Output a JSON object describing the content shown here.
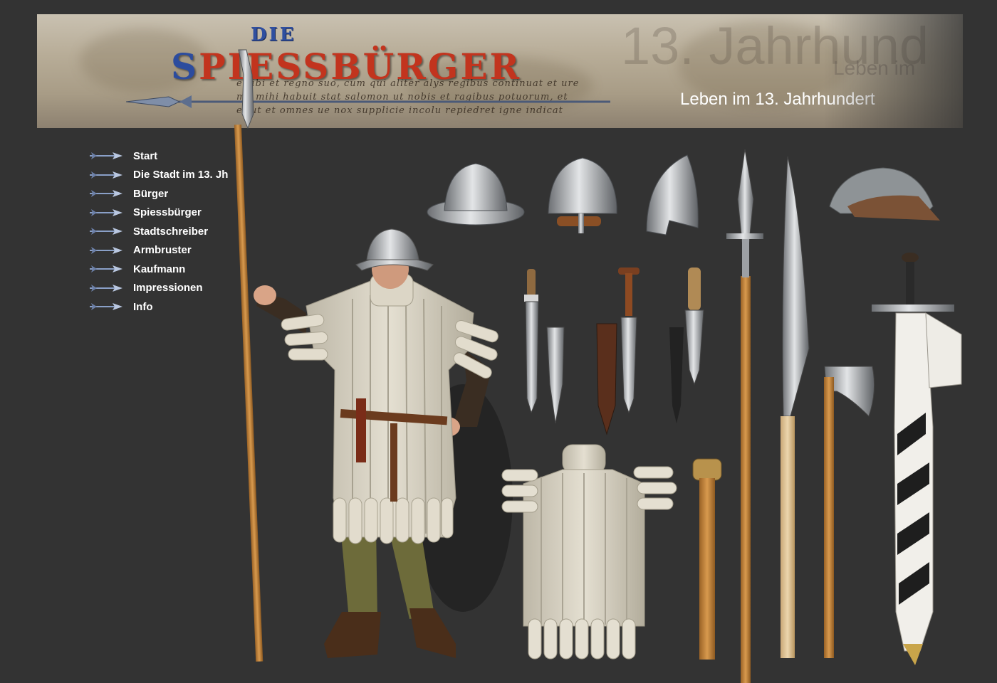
{
  "header": {
    "logo_die": "DIE",
    "logo_main_first": "S",
    "logo_main_rest": "PIESSBÜRGER",
    "subtitle": "Leben im 13. Jahrhundert",
    "bg_year_text": "13. Jahrhund",
    "bg_leben_text": "Leben im",
    "script_lines": [
      "e sibi et regno suo, cum qui aliter alys regibus continuat et ure",
      "me mihi habuit stat salomon ut nobis et ragibus potuorum, et",
      "et ut et omnes ue nox supplicie incolu repiedret igne indicat"
    ]
  },
  "nav": {
    "items": [
      {
        "label": "Start"
      },
      {
        "label": "Die Stadt im 13. Jh"
      },
      {
        "label": "Bürger"
      },
      {
        "label": "Spiessbürger"
      },
      {
        "label": "Stadtschreiber"
      },
      {
        "label": "Armbruster"
      },
      {
        "label": "Kaufmann"
      },
      {
        "label": "Impressionen"
      },
      {
        "label": "Info"
      }
    ]
  },
  "icons": {
    "nav_arrow": "spear-arrow-icon"
  },
  "colors": {
    "background": "#333333",
    "logo_blue": "#2c4c9e",
    "logo_red": "#c2341e",
    "nav_text": "#ffffff",
    "metal": "#b9bcbf",
    "padded_cloth": "#dcd6c6",
    "wood": "#c98a3c"
  }
}
